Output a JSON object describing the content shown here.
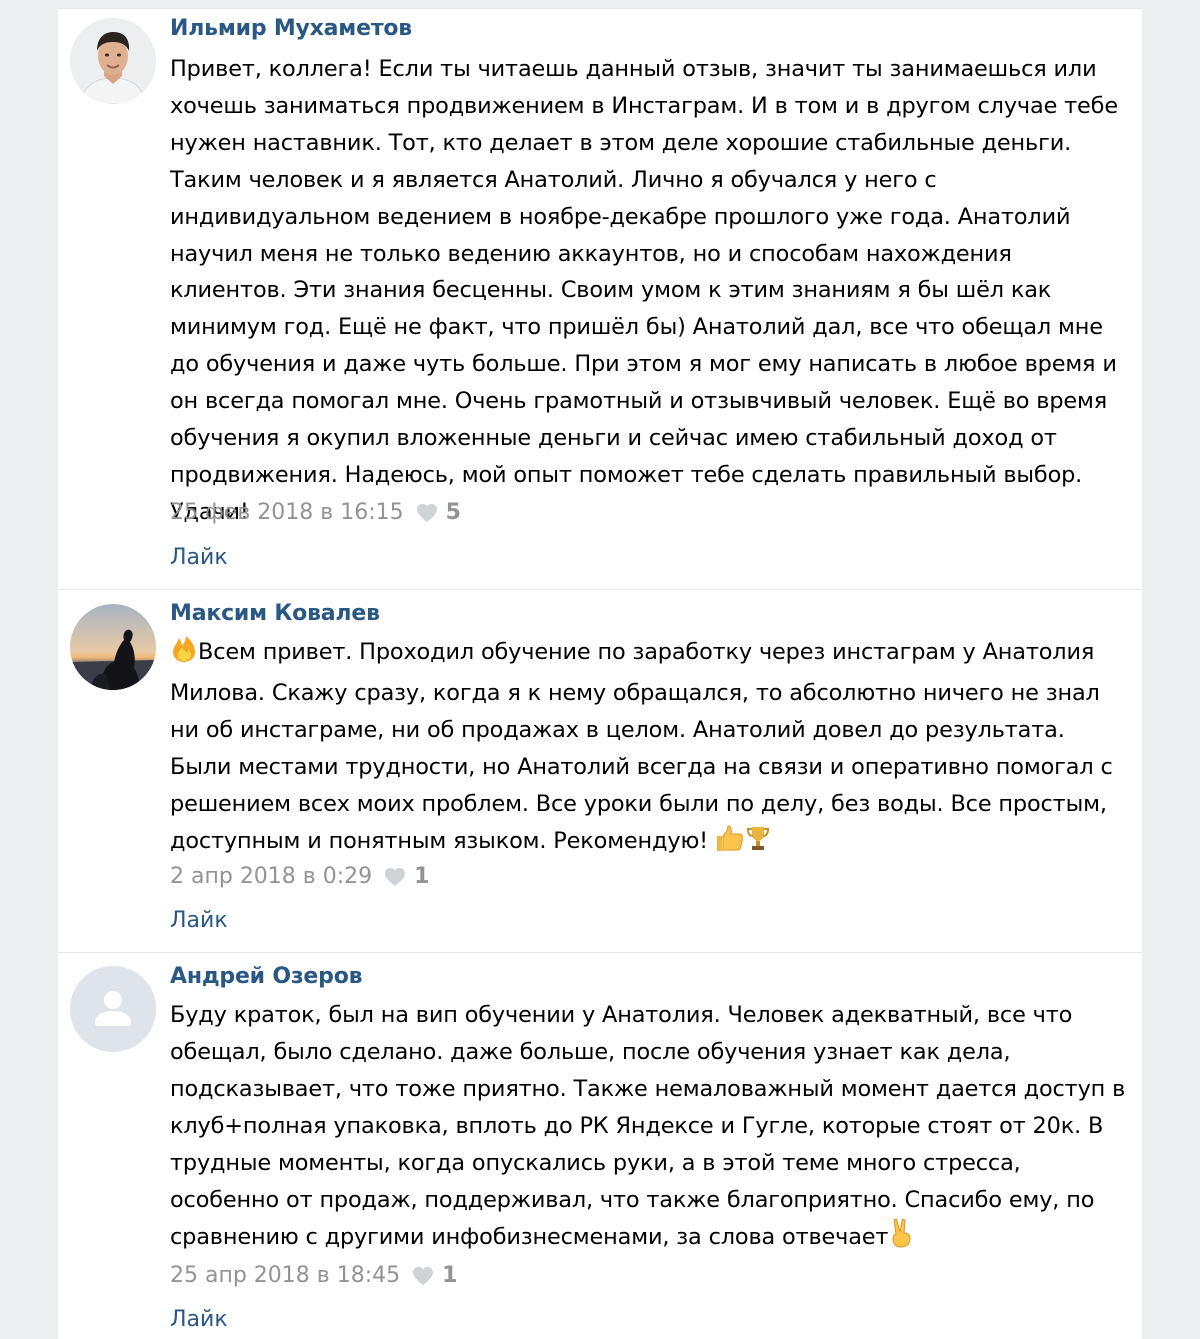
{
  "comments": [
    {
      "author": "Ильмир Мухаметов",
      "text": "Привет, коллега! Если ты читаешь данный отзыв, значит ты занимаешься или хочешь заниматься продвижением в Инстаграм. И в том и в другом случае тебе нужен наставник. Тот, кто делает в этом деле хорошие стабильные деньги. Таким человек и я является Анатолий. Лично я обучался у него с индивидуальном ведением в ноябре-декабре прошлого уже года. Анатолий научил меня не только ведению аккаунтов, но и способам нахождения клиентов. Эти знания бесценны. Своим умом к этим знаниям я бы шёл как минимум год. Ещё не факт, что пришёл бы) Анатолий дал, все что обещал мне до обучения и даже чуть больше. При этом я мог ему написать в любое время и он всегда помогал мне. Очень грамотный и отзывчивый человек. Ещё во время обучения я окупил вложенные деньги и сейчас имею стабильный доход от продвижения. Надеюсь, мой опыт поможет тебе сделать правильный выбор. Удачи!",
      "date": "25 фев 2018 в 16:15",
      "likes": "5",
      "like_label": "Лайк",
      "avatar_icon": "user-photo-icon"
    },
    {
      "author": "Максим Ковалев",
      "text_prefix_emoji": "fire-emoji-icon",
      "text": "Всем привет. Проходил обучение по заработку через инстаграм у Анатолия Милова. Скажу сразу, когда я к нему обращался, то абсолютно ничего не знал ни об инстаграме, ни об продажах в целом. Анатолий довел до результата. Были местами трудности, но Анатолий всегда на связи и оперативно помогал с решением всех моих проблем. Все уроки были по делу, без воды. Все простым, доступным и понятным языком. Рекомендую!",
      "text_suffix_emoji": [
        "thumbs-up-emoji-icon",
        "trophy-emoji-icon"
      ],
      "date": "2 апр 2018 в 0:29",
      "likes": "1",
      "like_label": "Лайк",
      "avatar_icon": "user-photo-sunset-icon"
    },
    {
      "author": "Андрей Озеров",
      "text": "Буду краток, был на вип обучении у Анатолия. Человек адекватный, все что обещал, было сделано. даже больше, после обучения узнает как дела, подсказывает, что тоже приятно. Также немаловажный момент дается доступ в клуб+полная упаковка, вплоть до РК Яндексе и Гугле, которые стоят от 20к. В трудные моменты, когда опускались руки, а в этой теме много стресса, особенно от продаж, поддерживал, что также благоприятно. Спасибо ему, по сравнению с другими инфобизнесменами, за слова отвечает",
      "text_suffix_emoji": [
        "victory-hand-emoji-icon"
      ],
      "date": "25 апр 2018 в 18:45",
      "likes": "1",
      "like_label": "Лайк",
      "avatar_icon": "default-user-placeholder-icon"
    }
  ],
  "colors": {
    "link": "#2a5885",
    "meta": "#939393",
    "background": "#edeef0",
    "card": "#ffffff"
  }
}
